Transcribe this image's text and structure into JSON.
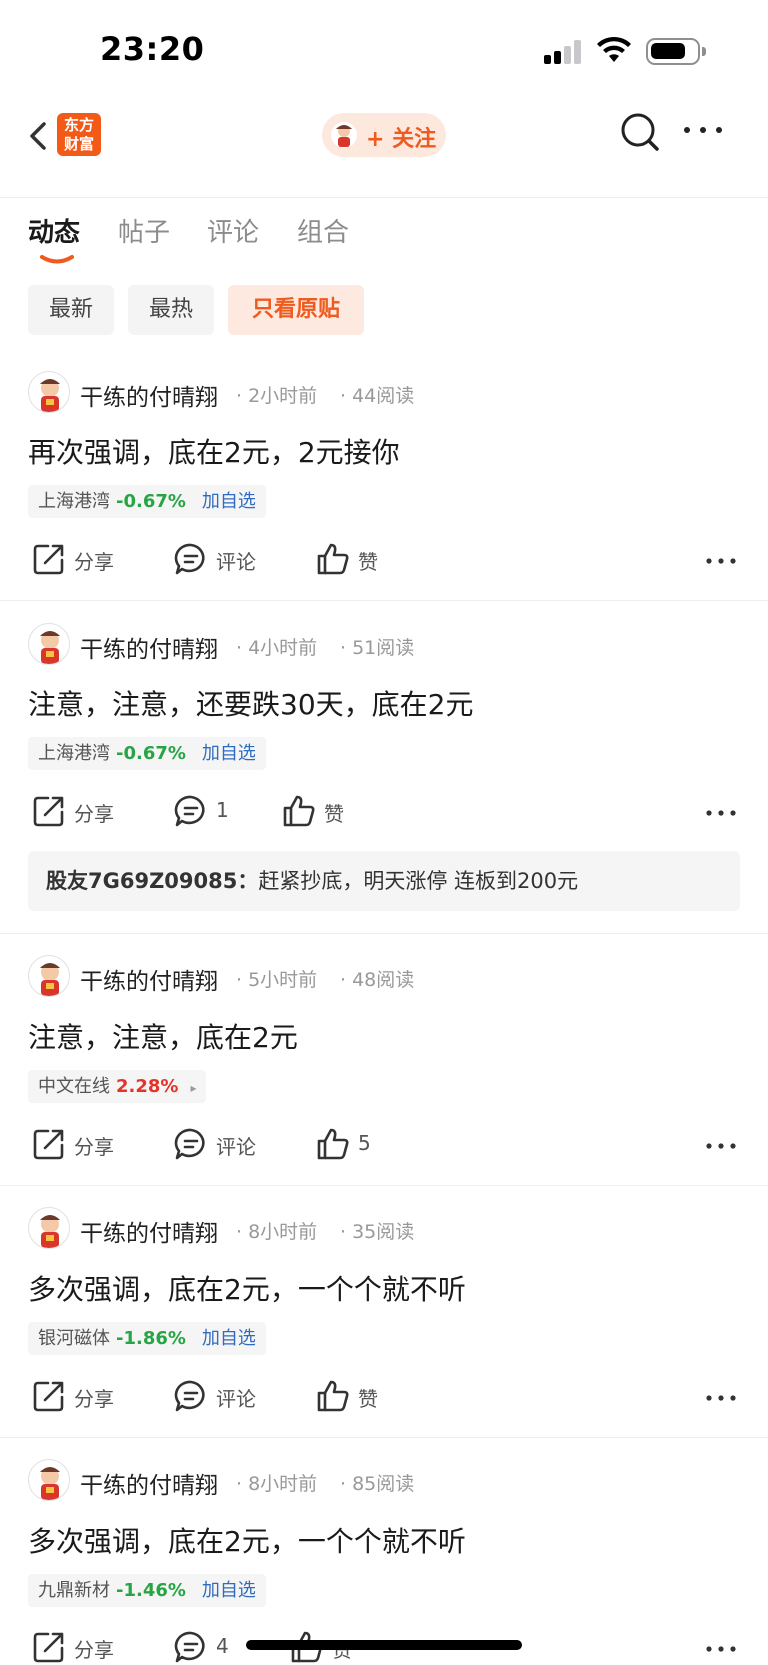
{
  "status_bar": {
    "time": "23:20"
  },
  "nav": {
    "app_logo_line1": "东方",
    "app_logo_line2": "财富",
    "follow_label": "+ 关注",
    "accent_color": "#ef5a1f"
  },
  "tabs": [
    {
      "label": "动态",
      "active": true
    },
    {
      "label": "帖子"
    },
    {
      "label": "评论"
    },
    {
      "label": "组合"
    }
  ],
  "filters": [
    {
      "label": "最新"
    },
    {
      "label": "最热"
    },
    {
      "label": "只看原贴",
      "active": true
    }
  ],
  "posts": [
    {
      "author": "干练的付晴翔",
      "time": "· 2小时前",
      "reads": "· 44阅读",
      "text": "再次强调，底在2元，2元接你",
      "stock": {
        "name": "上海港湾",
        "change": "-0.67%",
        "direction": "down",
        "add": "加自选"
      },
      "share": "分享",
      "comment": "评论",
      "like": "赞"
    },
    {
      "author": "干练的付晴翔",
      "time": "· 4小时前",
      "reads": "· 51阅读",
      "text": "注意，注意，还要跌30天，底在2元",
      "stock": {
        "name": "上海港湾",
        "change": "-0.67%",
        "direction": "down",
        "add": "加自选"
      },
      "share": "分享",
      "comment": "1",
      "like": "赞",
      "reply": {
        "user": "股友7G69Z09085：",
        "text": "赶紧抄底，明天涨停 连板到200元"
      }
    },
    {
      "author": "干练的付晴翔",
      "time": "· 5小时前",
      "reads": "· 48阅读",
      "text": "注意，注意，底在2元",
      "stock": {
        "name": "中文在线",
        "change": "2.28%",
        "direction": "up",
        "arrow": "▸"
      },
      "share": "分享",
      "comment": "评论",
      "like": "5"
    },
    {
      "author": "干练的付晴翔",
      "time": "· 8小时前",
      "reads": "· 35阅读",
      "text": "多次强调，底在2元，一个个就不听",
      "stock": {
        "name": "银河磁体",
        "change": "-1.86%",
        "direction": "down",
        "add": "加自选"
      },
      "share": "分享",
      "comment": "评论",
      "like": "赞"
    },
    {
      "author": "干练的付晴翔",
      "time": "· 8小时前",
      "reads": "· 85阅读",
      "text": "多次强调，底在2元，一个个就不听",
      "stock": {
        "name": "九鼎新材",
        "change": "-1.46%",
        "direction": "down",
        "add": "加自选"
      },
      "share": "分享",
      "comment": "4",
      "like": "赞"
    }
  ]
}
